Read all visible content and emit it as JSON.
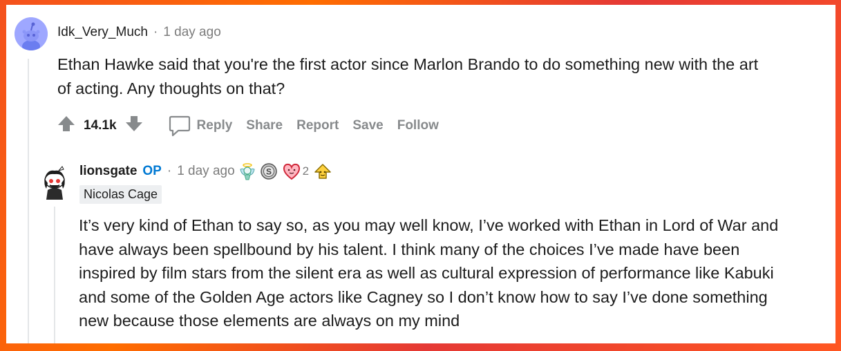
{
  "comment": {
    "username": "Idk_Very_Much",
    "separator": "·",
    "time": "1 day ago",
    "body_line1": "Ethan Hawke said that you're the first actor since Marlon Brando to do something new with the art",
    "body_line2": "of acting. Any thoughts on that?",
    "votes": "14.1k",
    "actions": {
      "reply": "Reply",
      "share": "Share",
      "report": "Report",
      "save": "Save",
      "follow": "Follow"
    }
  },
  "reply": {
    "username": "lionsgate",
    "op_badge": "OP",
    "separator": "·",
    "time": "1 day ago",
    "award_count": "2",
    "flair": "Nicolas Cage",
    "body_lines": [
      "It’s very kind of Ethan to say so, as you may well know, I’ve worked with Ethan in Lord of War and",
      "have always been spellbound by his talent. I think many of the choices I’ve made have been",
      "inspired by film stars from the silent era as well as cultural expression of performance like Kabuki",
      "and some of the Golden Age actors like Cagney so I don’t know how to say I’ve done something",
      "new because those elements are always on my mind"
    ]
  },
  "colors": {
    "background": "#ff5722",
    "op_blue": "#0079d3",
    "meta_gray": "#7c7c7c",
    "action_gray": "#878a8c"
  }
}
